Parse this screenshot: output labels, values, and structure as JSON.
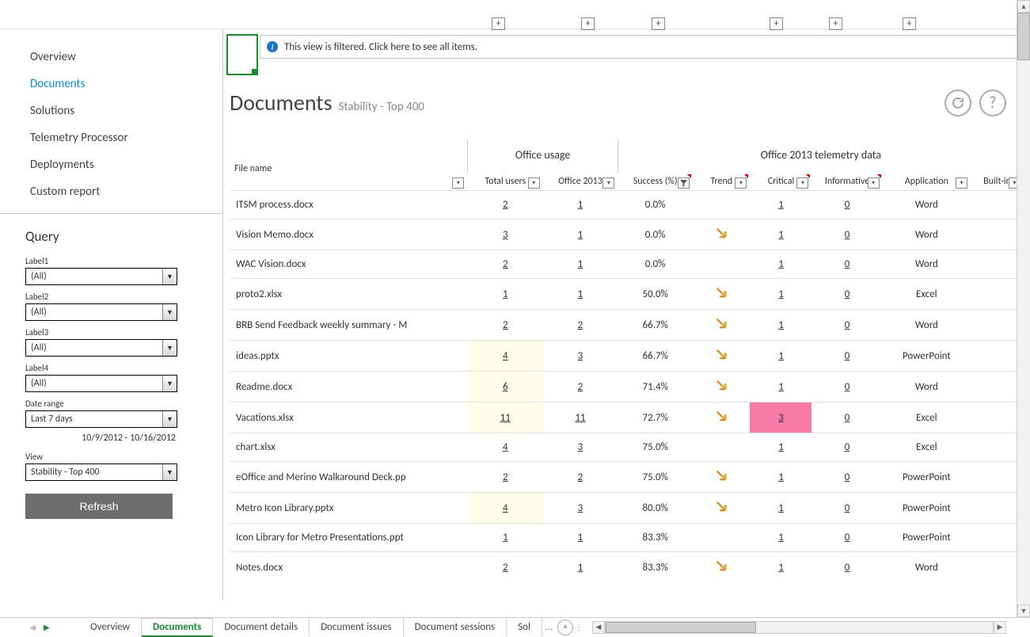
{
  "banner": {
    "filter_text": "This view is filtered. Click here to see all items."
  },
  "title": {
    "heading": "Documents",
    "subtitle": "Stability - Top 400"
  },
  "sidebar": {
    "items": [
      {
        "label": "Overview",
        "active": false
      },
      {
        "label": "Documents",
        "active": true
      },
      {
        "label": "Solutions",
        "active": false
      },
      {
        "label": "Telemetry Processor",
        "active": false
      },
      {
        "label": "Deployments",
        "active": false
      },
      {
        "label": "Custom report",
        "active": false
      }
    ]
  },
  "query": {
    "title": "Query",
    "labels": {
      "label1": "Label1",
      "label2": "Label2",
      "label3": "Label3",
      "label4": "Label4",
      "date_range": "Date range",
      "view": "View"
    },
    "values": {
      "label1": "(All)",
      "label2": "(All)",
      "label3": "(All)",
      "label4": "(All)",
      "date_range": "Last 7 days",
      "view": "Stability - Top 400"
    },
    "date_display": "10/9/2012 - 10/16/2012",
    "refresh": "Refresh"
  },
  "table": {
    "groups": {
      "file": "File name",
      "usage": "Office usage",
      "telemetry": "Office 2013 telemetry data"
    },
    "columns": {
      "total_users": "Total users",
      "office_2013": "Office 2013",
      "success": "Success (%)",
      "trend": "Trend",
      "critical": "Critical",
      "informative": "Informative",
      "application": "Application",
      "builtin": "Built-in"
    },
    "rows": [
      {
        "file": "ITSM process.docx",
        "total": "2",
        "o2013": "1",
        "success": "0.0%",
        "trend": false,
        "critical": "1",
        "info": "0",
        "app": "Word"
      },
      {
        "file": "Vision Memo.docx",
        "total": "3",
        "o2013": "1",
        "success": "0.0%",
        "trend": true,
        "critical": "1",
        "info": "0",
        "app": "Word"
      },
      {
        "file": "WAC Vision.docx",
        "total": "2",
        "o2013": "1",
        "success": "0.0%",
        "trend": false,
        "critical": "1",
        "info": "0",
        "app": "Word"
      },
      {
        "file": "proto2.xlsx",
        "total": "1",
        "o2013": "1",
        "success": "50.0%",
        "trend": true,
        "critical": "1",
        "info": "0",
        "app": "Excel"
      },
      {
        "file": "BRB Send Feedback weekly summary - M",
        "total": "2",
        "o2013": "2",
        "success": "66.7%",
        "trend": true,
        "critical": "1",
        "info": "0",
        "app": "Word"
      },
      {
        "file": "ideas.pptx",
        "total": "4",
        "o2013": "3",
        "success": "66.7%",
        "trend": true,
        "critical": "1",
        "info": "0",
        "app": "PowerPoint",
        "hl_total": true
      },
      {
        "file": "Readme.docx",
        "total": "6",
        "o2013": "2",
        "success": "71.4%",
        "trend": true,
        "critical": "1",
        "info": "0",
        "app": "Word",
        "hl_total": true
      },
      {
        "file": "Vacations.xlsx",
        "total": "11",
        "o2013": "11",
        "success": "72.7%",
        "trend": true,
        "critical": "3",
        "info": "0",
        "app": "Excel",
        "hl_total": true,
        "hl_crit": true
      },
      {
        "file": "chart.xlsx",
        "total": "4",
        "o2013": "3",
        "success": "75.0%",
        "trend": false,
        "critical": "1",
        "info": "0",
        "app": "Excel"
      },
      {
        "file": "eOffice and Merino Walkaround Deck.pp",
        "total": "2",
        "o2013": "2",
        "success": "75.0%",
        "trend": true,
        "critical": "1",
        "info": "0",
        "app": "PowerPoint"
      },
      {
        "file": "Metro Icon Library.pptx",
        "total": "4",
        "o2013": "3",
        "success": "80.0%",
        "trend": true,
        "critical": "1",
        "info": "0",
        "app": "PowerPoint",
        "hl_total": true
      },
      {
        "file": "Icon Library for Metro Presentations.ppt",
        "total": "1",
        "o2013": "1",
        "success": "83.3%",
        "trend": false,
        "critical": "1",
        "info": "0",
        "app": "PowerPoint"
      },
      {
        "file": "Notes.docx",
        "total": "2",
        "o2013": "1",
        "success": "83.3%",
        "trend": true,
        "critical": "1",
        "info": "0",
        "app": "Word"
      }
    ]
  },
  "tabs": {
    "items": [
      {
        "label": "Overview",
        "active": false
      },
      {
        "label": "Documents",
        "active": true
      },
      {
        "label": "Document details",
        "active": false
      },
      {
        "label": "Document issues",
        "active": false
      },
      {
        "label": "Document sessions",
        "active": false
      },
      {
        "label": "Sol",
        "active": false,
        "truncated": true
      }
    ]
  }
}
